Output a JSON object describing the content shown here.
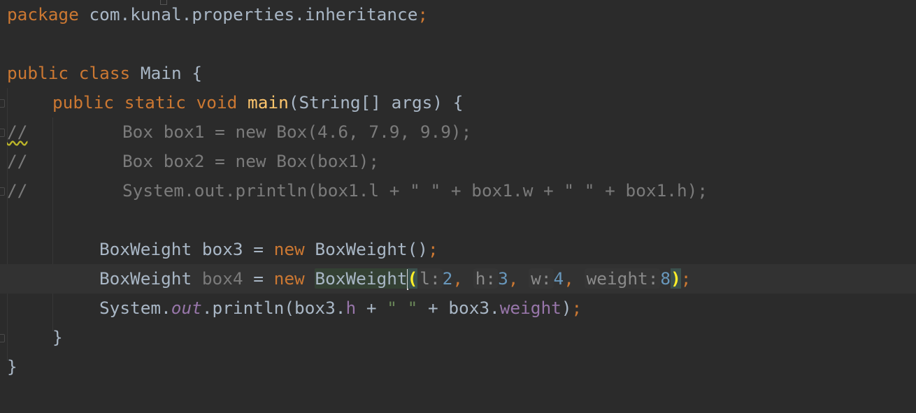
{
  "editor": {
    "language": "Java",
    "theme_colors": {
      "background": "#2b2b2b",
      "current_line": "#323232",
      "keyword": "#cc7832",
      "method_declaration": "#ffc66d",
      "identifier": "#a9b7c6",
      "comment": "#7b7b7b",
      "string": "#6a8759",
      "field": "#9876aa",
      "number": "#6897bb",
      "parameter_hint": "#8a8a8a",
      "matched_brace": "#ffef28"
    },
    "lines": [
      {
        "tokens": {
          "kw_package": "package",
          "rest": " com.kunal.properties.inheritance",
          "semi": ";"
        }
      },
      {
        "tokens": {
          "kw_public": "public",
          "kw_class": "class",
          "rest": " Main {"
        }
      },
      {
        "tokens": {
          "kw_public": "public",
          "kw_static": "static",
          "kw_void": "void",
          "method": "main",
          "rest": "(String[] args) {"
        }
      },
      {
        "tokens": {
          "comment_mark": "//",
          "code": "Box box1 = new Box(4.6, 7.9, 9.9);"
        }
      },
      {
        "tokens": {
          "comment_mark": "//",
          "code": "Box box2 = new Box(box1);"
        }
      },
      {
        "tokens": {
          "comment_mark": "//",
          "code": "System.out.println(box1.l + \" \" + box1.w + \" \" + box1.h);"
        }
      },
      {
        "tokens": {
          "type": "BoxWeight",
          "var": " box3 = ",
          "kw_new": "new",
          "ctor": " BoxWeight()",
          "semi": ";"
        }
      },
      {
        "tokens": {
          "type": "BoxWeight",
          "var_dim": "box4",
          "eq": " = ",
          "kw_new": "new",
          "ctor": "BoxWeight",
          "open_paren": "(",
          "hint_l": "l:",
          "val_l": "2",
          "hint_h": "h:",
          "val_h": "3",
          "hint_w": "w:",
          "val_w": "4",
          "hint_weight": "weight:",
          "val_weight": "8",
          "close_paren": ")",
          "comma": ",",
          "semi": ";"
        }
      },
      {
        "tokens": {
          "system": "System.",
          "out": "out",
          "println": ".println(box3.",
          "field_h": "h",
          "plus1": " + ",
          "str_space": "\" \"",
          "plus2": " + box3.",
          "field_weight": "weight",
          "close": ")",
          "semi": ";"
        }
      },
      {
        "tokens": {
          "brace": "}"
        }
      },
      {
        "tokens": {
          "brace": "}"
        }
      }
    ]
  }
}
